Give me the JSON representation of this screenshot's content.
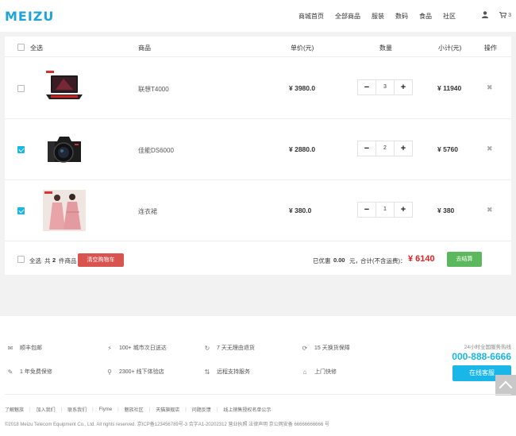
{
  "header": {
    "logo": "MEIZU",
    "nav": [
      "商城首页",
      "全部商品",
      "服装",
      "数码",
      "食品",
      "社区"
    ],
    "user_icon": "user-icon",
    "cart_icon": "cart-icon",
    "cart_count": "3"
  },
  "cart": {
    "headers": {
      "select_all": "全选",
      "product": "商品",
      "unit_price": "单价(元)",
      "quantity": "数量",
      "subtotal": "小计(元)",
      "action": "操作"
    },
    "items": [
      {
        "name": "联想T4000",
        "price": "¥ 3980.0",
        "qty": "3",
        "subtotal": "¥ 11940",
        "checked": false,
        "image": "laptop"
      },
      {
        "name": "佳能DS6000",
        "price": "¥ 2880.0",
        "qty": "2",
        "subtotal": "¥ 5760",
        "checked": true,
        "image": "camera"
      },
      {
        "name": "连衣裙",
        "price": "¥ 380.0",
        "qty": "1",
        "subtotal": "¥ 380",
        "checked": true,
        "image": "dress"
      }
    ],
    "minus": "−",
    "plus": "+",
    "delete": "✖",
    "footer": {
      "select_all": "全选",
      "count_prefix": "共",
      "count": "2",
      "count_suffix": "件商品",
      "clear_button": "清空购物车",
      "discount_label": "已优惠",
      "discount": "0.00",
      "discount_unit": "元，",
      "total_label": "合计(不含运费)：",
      "total": "¥ 6140",
      "checkout_button": "去结算"
    }
  },
  "footer": {
    "services": [
      {
        "icon": "mail-icon",
        "glyph": "✉",
        "label": "顺丰包邮"
      },
      {
        "icon": "lightning-icon",
        "glyph": "⚡",
        "label": "100+ 城市次日送达"
      },
      {
        "icon": "refresh-icon",
        "glyph": "↻",
        "label": "7 天无理由退货"
      },
      {
        "icon": "sync-icon",
        "glyph": "⟳",
        "label": "15 天换货保障"
      },
      {
        "icon": "wrench-icon",
        "glyph": "✎",
        "label": "1 年免费保修"
      },
      {
        "icon": "location-icon",
        "glyph": "⚲",
        "label": "2300+ 线下体验店"
      },
      {
        "icon": "sort-icon",
        "glyph": "⇅",
        "label": "远程支持服务"
      },
      {
        "icon": "home-icon",
        "glyph": "⌂",
        "label": "上门快修"
      }
    ],
    "hotline_title": "24小时全国服务热线",
    "hotline_phone": "000-888-6666",
    "online_button": "在线客服",
    "links": [
      "了解魅族",
      "加入我们",
      "联系我们",
      "Flyme",
      "魅族社区",
      "天猫旗舰店",
      "问题反馈",
      "线上销售授权名单公示"
    ],
    "copyright": "©2018 Meizu Telecom Equipment Co., Ltd. All rights reserved.    京ICP备123456789号-3  合字A1-20202312  营业执照  法律声明  京公网安备 66666666666 号"
  }
}
